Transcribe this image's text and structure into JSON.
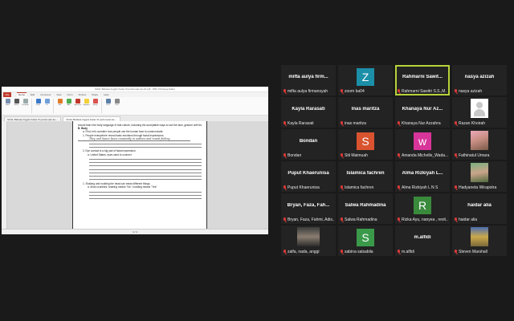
{
  "shared_screen": {
    "window_title": "SOAL Bahasa Inggris Kelas XI pertemuan ke-10.pdf - PDF-XChange Editor",
    "file_tab": "File",
    "menu_tabs": [
      "Home",
      "Edit",
      "Comment",
      "View",
      "Form",
      "Protect",
      "Share",
      "Help"
    ],
    "ribbon_buttons": [
      "Hand",
      "Select",
      "Snapshot",
      "Zoom",
      "Fit",
      "Edit",
      "Add",
      "Typewriter",
      "Highlight",
      "Stamp",
      "Find",
      "Print"
    ],
    "doc_tabs": [
      "SOAL Bahasa Inggris Kelas XI pertemuan ke-...",
      "SOAL Bahasa Inggris Kelas XI pertemuan ke-..."
    ],
    "status": "4 / 4",
    "page": {
      "intro": "should learn the body language of that culture, including the acceptable ways to use the face, gesture with the body, and make physical contact.",
      "section": "B. Body",
      "item_a": "a. First, let's consider how people use the human face to communicate.",
      "q1": "1. People everywhere reveal basic emotions through facial expressions.",
      "q1_answer": "They and Space faces constantly in authors and reveal feeling",
      "q2": "2. Eye contact is a big part of facial expression.",
      "q2a": "a. United States, eyes used to connect",
      "q3": "1. Shaking and nodding the head can mean different things.",
      "q3a": "a. Most countries, shaking means \"No\"; nodding means \"Yes\""
    }
  },
  "participants": [
    {
      "name": "mifta aulya firm...",
      "label": "mifta aulya firmansyah",
      "kind": "name"
    },
    {
      "name": "",
      "label": "zoom ba04",
      "kind": "avatar",
      "letter": "Z",
      "color": "#1c8fa8"
    },
    {
      "name": "Rahmarni  Sawit...",
      "label": "Rahmarni Sawitri S.S.,M...",
      "kind": "name",
      "talking": true
    },
    {
      "name": "nasya azizah",
      "label": "nasya azizah",
      "kind": "name"
    },
    {
      "name": "Kayla Rarasati",
      "label": "Kayla Rarasati",
      "kind": "name"
    },
    {
      "name": "Inas maritza",
      "label": "inas maritza",
      "kind": "name"
    },
    {
      "name": "Khanaya Nur Az...",
      "label": "Khanaya Nur Azzahra",
      "kind": "name"
    },
    {
      "name": "",
      "label": "Razan Khoirah",
      "kind": "photo",
      "photo": "blank"
    },
    {
      "name": "Bondan",
      "label": "Bondan",
      "kind": "name"
    },
    {
      "name": "",
      "label": "Siti Maimuah",
      "kind": "avatar",
      "letter": "S",
      "color": "#d9532f"
    },
    {
      "name": "",
      "label": "Amanda Michelle_Wada...",
      "kind": "avatar",
      "letter": "w",
      "color": "#d8359a"
    },
    {
      "name": "",
      "label": "Fathinatul Umara",
      "kind": "photo",
      "photo": "pink"
    },
    {
      "name": "Puput Khaerunisa",
      "label": "Puput Khaerunisa",
      "kind": "name"
    },
    {
      "name": "Islamica fachren",
      "label": "Islamica fachren",
      "kind": "name"
    },
    {
      "name": "Alma Rizkiyah L...",
      "label": "Alma Rizkiyah L N S",
      "kind": "name"
    },
    {
      "name": "",
      "label": "Hadyaneta Wirapotra",
      "kind": "photo",
      "photo": "green"
    },
    {
      "name": "Bryan, Faza, Fah...",
      "label": "Bryan, Faza, Fahmi, Adis...",
      "kind": "name"
    },
    {
      "name": "Salwa Rahmadina",
      "label": "Salwa Rahmadina",
      "kind": "name"
    },
    {
      "name": "",
      "label": "Rizka Ayu, nanyea , revit...",
      "kind": "avatar",
      "letter": "R",
      "color": "#3a8a3c"
    },
    {
      "name": "haidar alia",
      "label": "haidar alia",
      "kind": "name"
    },
    {
      "name": "",
      "label": "zalfa, nada, anggi",
      "kind": "photo",
      "photo": "dark"
    },
    {
      "name": "",
      "label": "sabina salsabila",
      "kind": "avatar",
      "letter": "S",
      "color": "#3a9a4a"
    },
    {
      "name": "m.alfidi",
      "label": "m.alfidi",
      "kind": "name"
    },
    {
      "name": "",
      "label": "Steven Marshall",
      "kind": "photo",
      "photo": "flag"
    }
  ]
}
